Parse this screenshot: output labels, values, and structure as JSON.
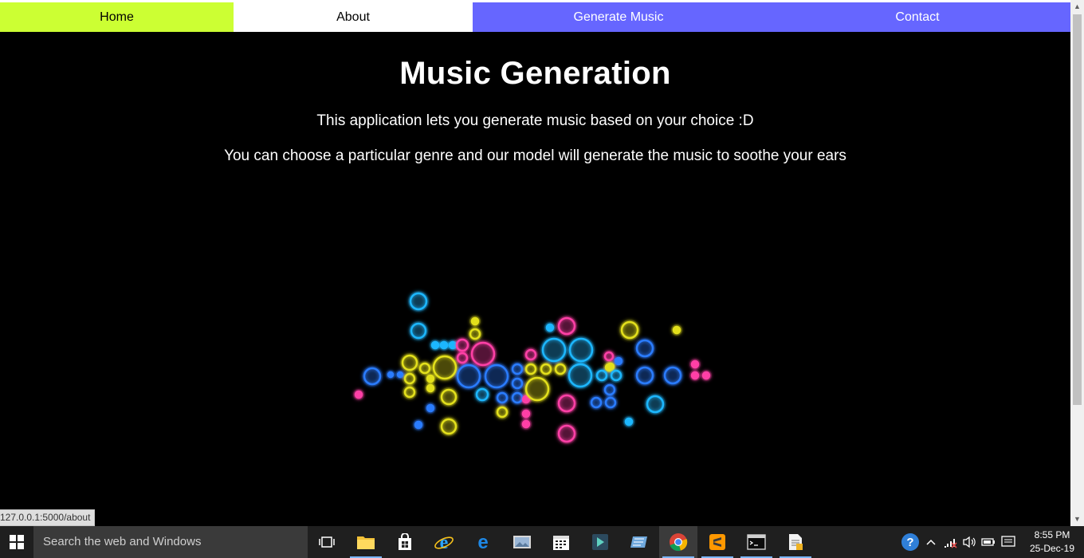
{
  "nav": {
    "home": "Home",
    "about": "About",
    "generate": "Generate Music",
    "contact": "Contact"
  },
  "page": {
    "title": "Music Generation",
    "line1": "This application lets you generate music based on your choice :D",
    "line2": "You can choose a particular genre and our model will generate the music to soothe your ears"
  },
  "visualizer": {
    "icon": "neon-circles-music-visualizer",
    "colors": {
      "cyan": "#1fb7ff",
      "blue": "#2b7cff",
      "yellow": "#e3e01a",
      "pink": "#ff3fa6"
    }
  },
  "status_bar": {
    "url": "127.0.0.1:5000/about"
  },
  "taskbar": {
    "search_placeholder": "Search the web and Windows",
    "apps": [
      "task-view",
      "file-explorer",
      "store",
      "internet-explorer",
      "edge",
      "photos",
      "calendar",
      "media-app",
      "sticky-app",
      "chrome",
      "sublime-text",
      "command-prompt",
      "notepad-app"
    ],
    "time": "8:55 PM",
    "date": "25-Dec-19"
  },
  "theme": {
    "home_bg": "#ccff33",
    "about_bg": "#ffffff",
    "nav_bg": "#6666ff",
    "page_bg": "#000000"
  }
}
